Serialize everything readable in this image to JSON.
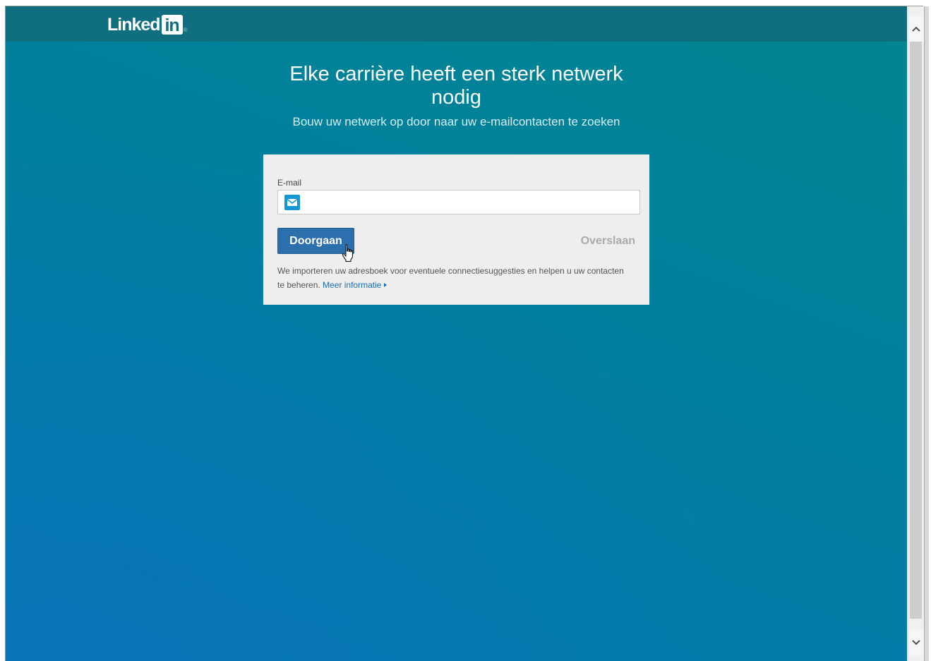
{
  "brand": {
    "logo_text": "Linked",
    "logo_in": "in",
    "logo_reg": "®"
  },
  "hero": {
    "title": "Elke carrière heeft een sterk netwerk nodig",
    "subtitle": "Bouw uw netwerk op door naar uw e-mailcontacten te zoeken"
  },
  "form": {
    "email_label": "E-mail",
    "email_value": "",
    "email_icon": "mail-icon",
    "continue_label": "Doorgaan",
    "skip_label": "Overslaan",
    "info_text": "We importeren uw adresboek voor eventuele connectiesuggesties en helpen u uw contacten te beheren.",
    "more_info_label": "Meer informatie"
  },
  "scrollbar": {
    "up_icon": "chevron-up-icon",
    "down_icon": "chevron-down-icon"
  },
  "colors": {
    "topbar": "#0f6f7f",
    "button": "#2b6fac",
    "link": "#1a6db4",
    "card": "#eeeeee"
  }
}
